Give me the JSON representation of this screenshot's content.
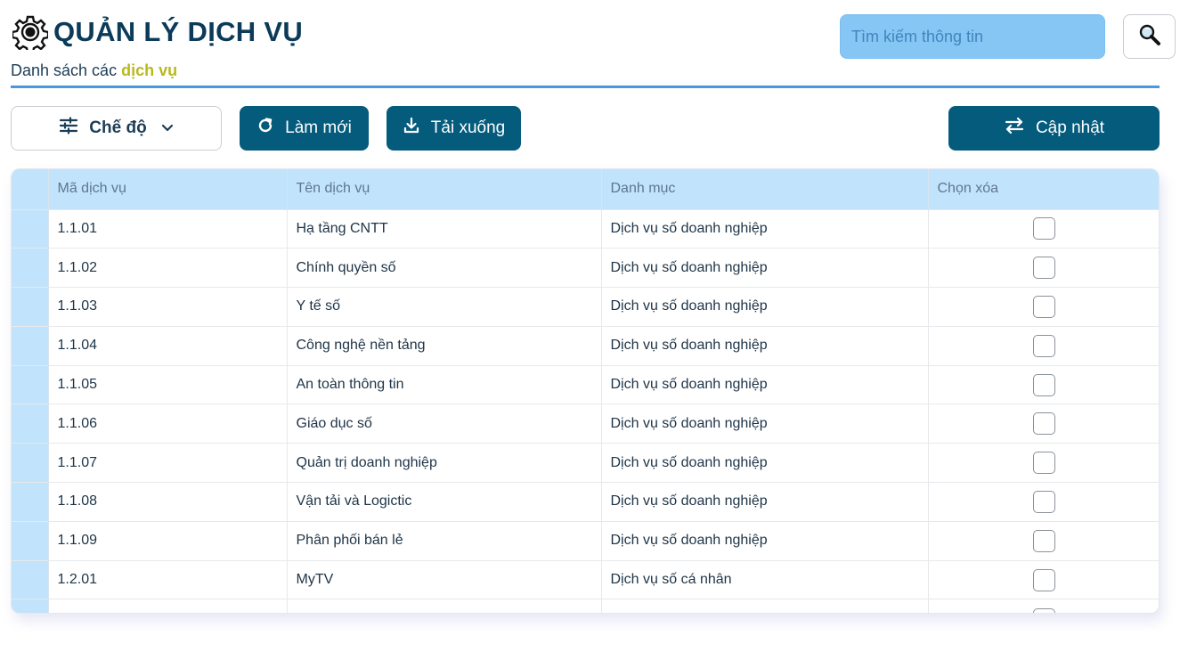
{
  "header": {
    "title": "QUẢN LÝ DỊCH VỤ",
    "subtitle_prefix": "Danh sách các",
    "subtitle_highlight": "dịch vụ"
  },
  "search": {
    "placeholder": "Tìm kiếm thông tin",
    "value": ""
  },
  "toolbar": {
    "mode_label": "Chế độ",
    "refresh_label": "Làm mới",
    "download_label": "Tải xuống",
    "update_label": "Cập nhật"
  },
  "icons": {
    "title": "gear-icon",
    "search": "search-icon",
    "mode": "sliders-icon",
    "mode_dropdown": "chevron-down-icon",
    "refresh": "refresh-icon",
    "download": "download-icon",
    "update": "swap-arrows-icon"
  },
  "colors": {
    "brand_dark": "#045b7c",
    "title_text": "#0b3b58",
    "highlight": "#b9b81f",
    "accent_rule": "#4a98de",
    "search_bg": "#86c6f5",
    "table_header_bg": "#c1e3fb"
  },
  "table": {
    "columns": [
      "Mã dịch vụ",
      "Tên dịch vụ",
      "Danh mục",
      "Chọn xóa"
    ],
    "rows": [
      {
        "code": "1.1.01",
        "name": "Hạ tầng CNTT",
        "category": "Dịch vụ số doanh nghiệp",
        "selected": false
      },
      {
        "code": "1.1.02",
        "name": "Chính quyền số",
        "category": "Dịch vụ số doanh nghiệp",
        "selected": false
      },
      {
        "code": "1.1.03",
        "name": "Y tế số",
        "category": "Dịch vụ số doanh nghiệp",
        "selected": false
      },
      {
        "code": "1.1.04",
        "name": "Công nghệ nền tảng",
        "category": "Dịch vụ số doanh nghiệp",
        "selected": false
      },
      {
        "code": "1.1.05",
        "name": "An toàn thông tin",
        "category": "Dịch vụ số doanh nghiệp",
        "selected": false
      },
      {
        "code": "1.1.06",
        "name": "Giáo dục số",
        "category": "Dịch vụ số doanh nghiệp",
        "selected": false
      },
      {
        "code": "1.1.07",
        "name": "Quản trị doanh nghiệp",
        "category": "Dịch vụ số doanh nghiệp",
        "selected": false
      },
      {
        "code": "1.1.08",
        "name": "Vận tải và Logictic",
        "category": "Dịch vụ số doanh nghiệp",
        "selected": false
      },
      {
        "code": "1.1.09",
        "name": "Phân phối bán lẻ",
        "category": "Dịch vụ số doanh nghiệp",
        "selected": false
      },
      {
        "code": "1.2.01",
        "name": "MyTV",
        "category": "Dịch vụ số cá nhân",
        "selected": false
      }
    ]
  }
}
